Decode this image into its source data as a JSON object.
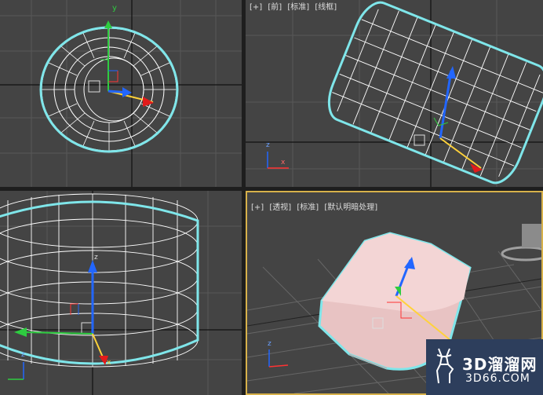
{
  "viewports": {
    "top": {
      "labels": []
    },
    "front": {
      "labels": [
        "[+]",
        "[前]",
        "[标准]",
        "[线框]"
      ]
    },
    "left": {
      "labels": []
    },
    "perspective": {
      "labels": [
        "[+]",
        "[透视]",
        "[标准]",
        "[默认明暗处理]"
      ]
    }
  },
  "axes": {
    "x": "x",
    "y": "y",
    "z": "z"
  },
  "colors": {
    "viewport_bg": "#444444",
    "grid": "#5a5a5a",
    "wire": "#ffffff",
    "selection": "#7fe6ea",
    "shaded": "#e8c3c3",
    "active_border": "#d7b14a"
  },
  "watermark": {
    "title": "3D溜溜网",
    "url": "3D66.COM"
  }
}
